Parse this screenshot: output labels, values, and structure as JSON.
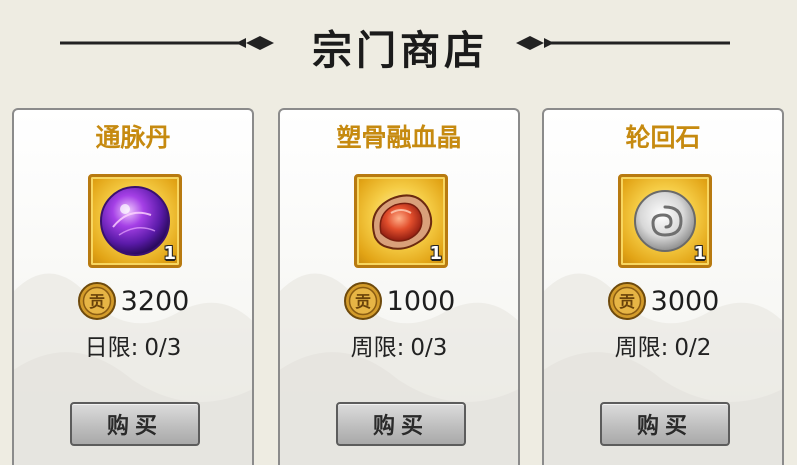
{
  "header": {
    "title": "宗门商店"
  },
  "currency": {
    "icon": "contribution-coin-icon",
    "glyph": "贡"
  },
  "items": [
    {
      "name": "通脉丹",
      "icon": "purple-orb-icon",
      "quantity": "1",
      "price": "3200",
      "limit_label": "日限:",
      "limit_value": "0/3",
      "buy_label": "购买"
    },
    {
      "name": "塑骨融血晶",
      "icon": "red-crystal-icon",
      "quantity": "1",
      "price": "1000",
      "limit_label": "周限:",
      "limit_value": "0/3",
      "buy_label": "购买"
    },
    {
      "name": "轮回石",
      "icon": "swirl-stone-icon",
      "quantity": "1",
      "price": "3000",
      "limit_label": "周限:",
      "limit_value": "0/2",
      "buy_label": "购买"
    }
  ],
  "colors": {
    "item_name": "#c68a10",
    "background": "#eeece2",
    "icon_frame": "#e2a416"
  }
}
